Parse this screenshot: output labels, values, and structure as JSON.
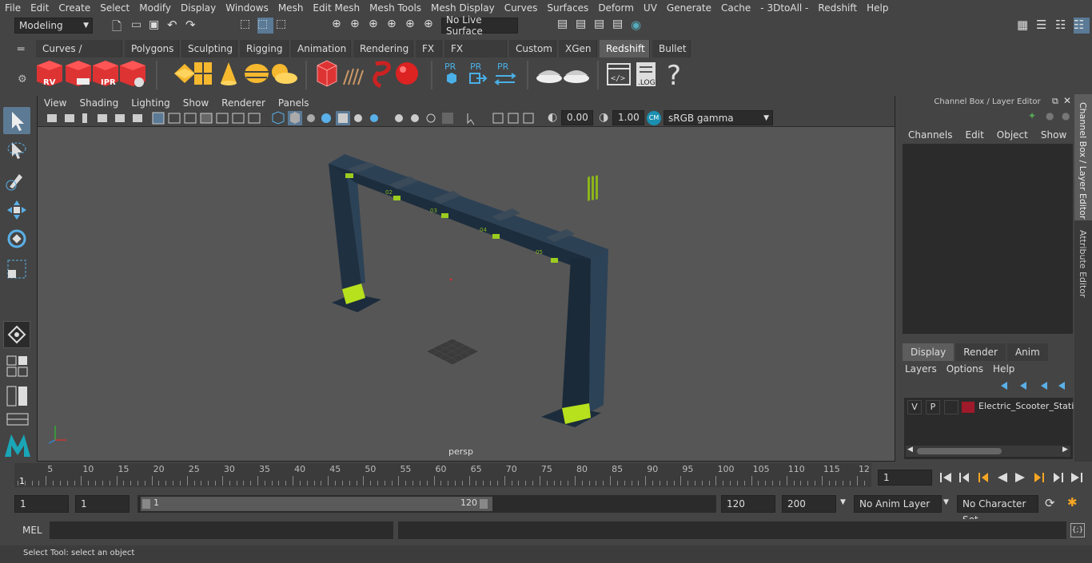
{
  "menu": [
    "File",
    "Edit",
    "Create",
    "Select",
    "Modify",
    "Display",
    "Windows",
    "Mesh",
    "Edit Mesh",
    "Mesh Tools",
    "Mesh Display",
    "Curves",
    "Surfaces",
    "Deform",
    "UV",
    "Generate",
    "Cache",
    "- 3DtoAll -",
    "Redshift",
    "Help"
  ],
  "workspace": "Modeling",
  "live_surface": "No Live Surface",
  "shelf_tabs": [
    "Curves / Surfaces",
    "Polygons",
    "Sculpting",
    "Rigging",
    "Animation",
    "Rendering",
    "FX",
    "FX Caching",
    "Custom",
    "XGen",
    "Redshift",
    "Bullet"
  ],
  "active_shelf": "Redshift",
  "shelf_labels": {
    "rv": "RV",
    "ipr": "IPR",
    "pr": "PR",
    "log": ".LOG",
    "help": "?"
  },
  "panel_menu": [
    "View",
    "Shading",
    "Lighting",
    "Show",
    "Renderer",
    "Panels"
  ],
  "viewport": {
    "exposure": "0.00",
    "gamma": "1.00",
    "color_space": "sRGB gamma",
    "camera": "persp",
    "station_labels": [
      "02",
      "03",
      "04",
      "05"
    ]
  },
  "channel_box": {
    "title": "Channel Box / Layer Editor",
    "menu": [
      "Channels",
      "Edit",
      "Object",
      "Show"
    ]
  },
  "layer_editor": {
    "tabs": [
      "Display",
      "Render",
      "Anim"
    ],
    "active": "Display",
    "menu": [
      "Layers",
      "Options",
      "Help"
    ],
    "layer": {
      "v": "V",
      "p": "P",
      "name": "Electric_Scooter_Statio",
      "color": "#9e1a2a"
    }
  },
  "side_tabs": [
    "Channel Box / Layer Editor",
    "Attribute Editor"
  ],
  "timeline": {
    "ticks": [
      "5",
      "10",
      "15",
      "20",
      "25",
      "30",
      "35",
      "40",
      "45",
      "50",
      "55",
      "60",
      "65",
      "70",
      "75",
      "80",
      "85",
      "90",
      "95",
      "100",
      "105",
      "110",
      "115",
      "12"
    ],
    "start_marker": "1",
    "current_frame": "1"
  },
  "range": {
    "start": "1",
    "start2": "1",
    "slider_start": "1",
    "slider_end": "120",
    "end": "120",
    "end2": "200",
    "anim_layer": "No Anim Layer",
    "char_set": "No Character Set"
  },
  "cmd": {
    "lang": "MEL"
  },
  "help_line": "Select Tool: select an object"
}
